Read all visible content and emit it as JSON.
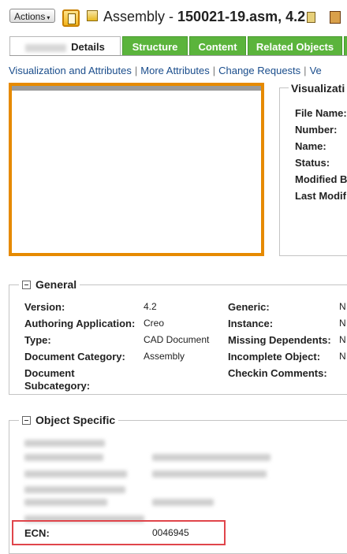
{
  "header": {
    "actions_label": "Actions",
    "actions_caret": "▾",
    "title_type": "Assembly - ",
    "title_name": "150021-19.asm, 4.2"
  },
  "tabs": [
    {
      "label": "Details",
      "active": true
    },
    {
      "label": "Structure",
      "active": false
    },
    {
      "label": "Content",
      "active": false
    },
    {
      "label": "Related Objects",
      "active": false
    }
  ],
  "sublinks": [
    "Visualization and Attributes",
    "More Attributes",
    "Change Requests",
    "Ve"
  ],
  "visualization": {
    "legend": "Visualizati",
    "labels": [
      "File Name:",
      "Number:",
      "Name:",
      "Status:",
      "Modified B",
      "Last Modif"
    ]
  },
  "general": {
    "legend": "General",
    "left": [
      {
        "label": "Version:",
        "value": "4.2"
      },
      {
        "label": "Authoring Application:",
        "value": "Creo"
      },
      {
        "label": "Type:",
        "value": "CAD Document"
      },
      {
        "label": "Document Category:",
        "value": "Assembly"
      },
      {
        "label": "Document Subcategory:",
        "value": ""
      }
    ],
    "right": [
      {
        "label": "Generic:",
        "value": "N"
      },
      {
        "label": "Instance:",
        "value": "N"
      },
      {
        "label": "Missing Dependents:",
        "value": "N"
      },
      {
        "label": "Incomplete Object:",
        "value": "N"
      },
      {
        "label": "Checkin Comments:",
        "value": ""
      }
    ]
  },
  "object_specific": {
    "legend": "Object Specific",
    "ecn_label": "ECN:",
    "ecn_value": "0046945"
  },
  "colors": {
    "tab_green": "#5bb43c",
    "thumb_border": "#e68a00",
    "link_blue": "#1a4d8c",
    "highlight_red": "#e0454b"
  }
}
